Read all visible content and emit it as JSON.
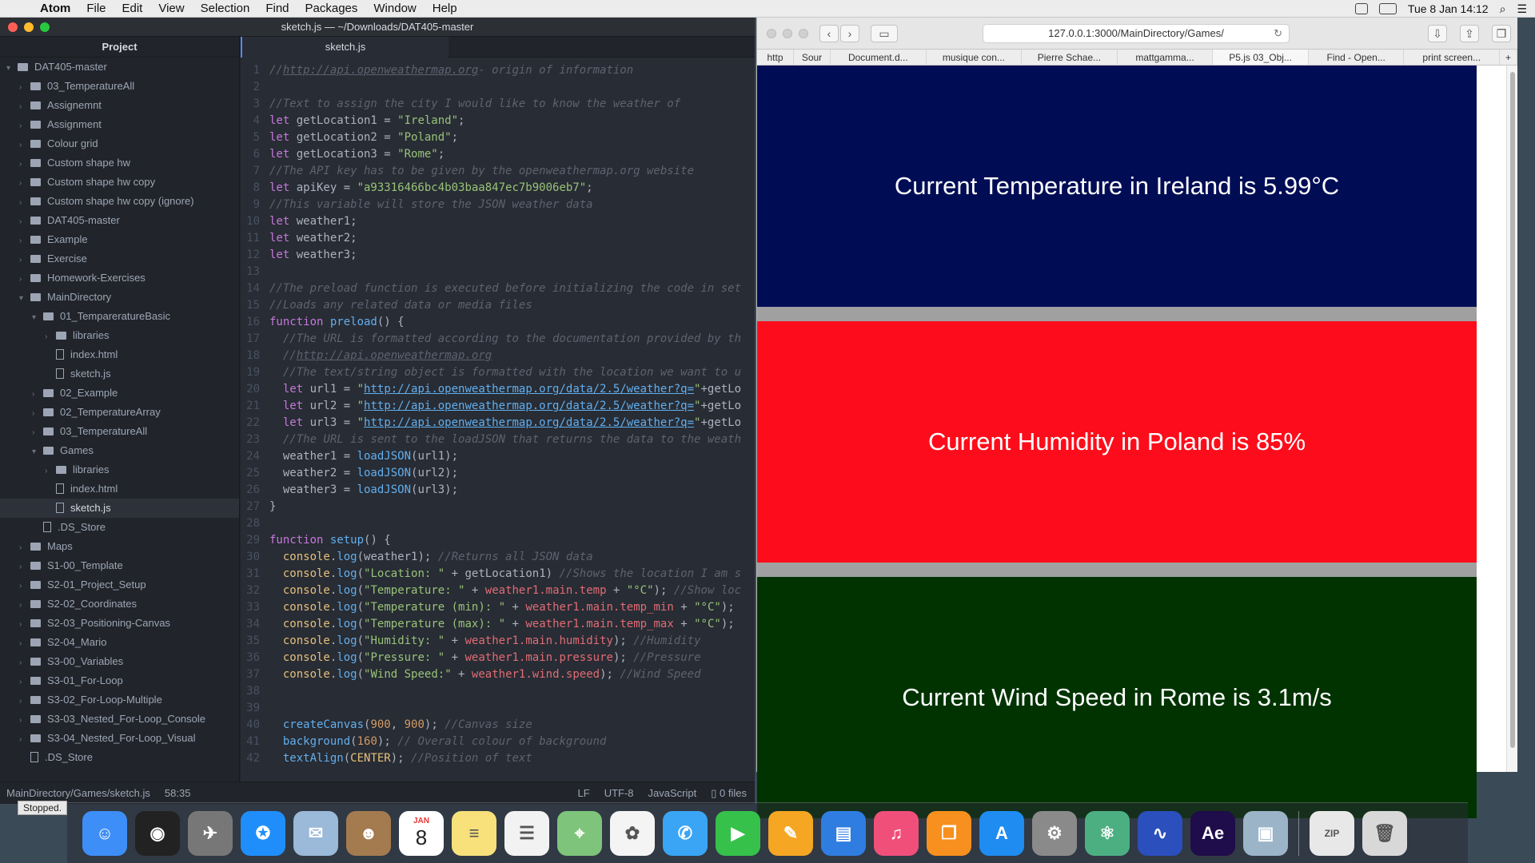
{
  "menubar": {
    "app": "Atom",
    "items": [
      "File",
      "Edit",
      "View",
      "Selection",
      "Find",
      "Packages",
      "Window",
      "Help"
    ],
    "datetime": "Tue 8 Jan  14:12"
  },
  "atom": {
    "title": "sketch.js — ~/Downloads/DAT405-master",
    "tree_header": "Project",
    "tab": "sketch.js",
    "tree": [
      {
        "label": "DAT405-master",
        "depth": 0,
        "type": "folder",
        "open": true
      },
      {
        "label": "03_TemperatureAll",
        "depth": 1,
        "type": "folder"
      },
      {
        "label": "Assignemnt",
        "depth": 1,
        "type": "folder"
      },
      {
        "label": "Assignment",
        "depth": 1,
        "type": "folder"
      },
      {
        "label": "Colour grid",
        "depth": 1,
        "type": "folder"
      },
      {
        "label": "Custom shape hw",
        "depth": 1,
        "type": "folder"
      },
      {
        "label": "Custom shape hw copy",
        "depth": 1,
        "type": "folder"
      },
      {
        "label": "Custom shape hw copy (ignore)",
        "depth": 1,
        "type": "folder"
      },
      {
        "label": "DAT405-master",
        "depth": 1,
        "type": "folder"
      },
      {
        "label": "Example",
        "depth": 1,
        "type": "folder"
      },
      {
        "label": "Exercise",
        "depth": 1,
        "type": "folder"
      },
      {
        "label": "Homework-Exercises",
        "depth": 1,
        "type": "folder"
      },
      {
        "label": "MainDirectory",
        "depth": 1,
        "type": "folder",
        "open": true
      },
      {
        "label": "01_TempareratureBasic",
        "depth": 2,
        "type": "folder",
        "open": true
      },
      {
        "label": "libraries",
        "depth": 3,
        "type": "folder"
      },
      {
        "label": "index.html",
        "depth": 3,
        "type": "file"
      },
      {
        "label": "sketch.js",
        "depth": 3,
        "type": "file"
      },
      {
        "label": "02_Example",
        "depth": 2,
        "type": "folder"
      },
      {
        "label": "02_TemperatureArray",
        "depth": 2,
        "type": "folder"
      },
      {
        "label": "03_TemperatureAll",
        "depth": 2,
        "type": "folder"
      },
      {
        "label": "Games",
        "depth": 2,
        "type": "folder",
        "open": true
      },
      {
        "label": "libraries",
        "depth": 3,
        "type": "folder"
      },
      {
        "label": "index.html",
        "depth": 3,
        "type": "file"
      },
      {
        "label": "sketch.js",
        "depth": 3,
        "type": "file",
        "selected": true
      },
      {
        "label": ".DS_Store",
        "depth": 2,
        "type": "file"
      },
      {
        "label": "Maps",
        "depth": 1,
        "type": "folder"
      },
      {
        "label": "S1-00_Template",
        "depth": 1,
        "type": "folder"
      },
      {
        "label": "S2-01_Project_Setup",
        "depth": 1,
        "type": "folder"
      },
      {
        "label": "S2-02_Coordinates",
        "depth": 1,
        "type": "folder"
      },
      {
        "label": "S2-03_Positioning-Canvas",
        "depth": 1,
        "type": "folder"
      },
      {
        "label": "S2-04_Mario",
        "depth": 1,
        "type": "folder"
      },
      {
        "label": "S3-00_Variables",
        "depth": 1,
        "type": "folder"
      },
      {
        "label": "S3-01_For-Loop",
        "depth": 1,
        "type": "folder"
      },
      {
        "label": "S3-02_For-Loop-Multiple",
        "depth": 1,
        "type": "folder"
      },
      {
        "label": "S3-03_Nested_For-Loop_Console",
        "depth": 1,
        "type": "folder"
      },
      {
        "label": "S3-04_Nested_For-Loop_Visual",
        "depth": 1,
        "type": "folder"
      },
      {
        "label": ".DS_Store",
        "depth": 1,
        "type": "file"
      }
    ],
    "code": [
      [
        [
          "c",
          "//"
        ],
        [
          "cu",
          "http://api.openweathermap.org"
        ],
        [
          "c",
          "- origin of information"
        ]
      ],
      [],
      [
        [
          "c",
          "//Text to assign the city I would like to know the weather of"
        ]
      ],
      [
        [
          "k",
          "let "
        ],
        [
          "p",
          "getLocation1 = "
        ],
        [
          "s",
          "\"Ireland\""
        ],
        [
          "p",
          ";"
        ]
      ],
      [
        [
          "k",
          "let "
        ],
        [
          "p",
          "getLocation2 = "
        ],
        [
          "s",
          "\"Poland\""
        ],
        [
          "p",
          ";"
        ]
      ],
      [
        [
          "k",
          "let "
        ],
        [
          "p",
          "getLocation3 = "
        ],
        [
          "s",
          "\"Rome\""
        ],
        [
          "p",
          ";"
        ]
      ],
      [
        [
          "c",
          "//The API key has to be given by the openweathermap.org website"
        ]
      ],
      [
        [
          "k",
          "let "
        ],
        [
          "p",
          "apiKey = "
        ],
        [
          "s",
          "\"a93316466bc4b03baa847ec7b9006eb7\""
        ],
        [
          "p",
          ";"
        ]
      ],
      [
        [
          "c",
          "//This variable will store the JSON weather data"
        ]
      ],
      [
        [
          "k",
          "let "
        ],
        [
          "p",
          "weather1;"
        ]
      ],
      [
        [
          "k",
          "let "
        ],
        [
          "p",
          "weather2;"
        ]
      ],
      [
        [
          "k",
          "let "
        ],
        [
          "p",
          "weather3;"
        ]
      ],
      [],
      [
        [
          "c",
          "//The preload function is executed before initializing the code in set"
        ]
      ],
      [
        [
          "c",
          "//Loads any related data or media files"
        ]
      ],
      [
        [
          "k",
          "function "
        ],
        [
          "f",
          "preload"
        ],
        [
          "p",
          "() {"
        ]
      ],
      [
        [
          "p",
          "  "
        ],
        [
          "c",
          "//The URL is formatted according to the documentation provided by th"
        ]
      ],
      [
        [
          "p",
          "  "
        ],
        [
          "c",
          "//"
        ],
        [
          "cu",
          "http://api.openweathermap.org"
        ]
      ],
      [
        [
          "p",
          "  "
        ],
        [
          "c",
          "//The text/string object is formatted with the location we want to u"
        ]
      ],
      [
        [
          "p",
          "  "
        ],
        [
          "k",
          "let "
        ],
        [
          "p",
          "url1 = "
        ],
        [
          "s",
          "\""
        ],
        [
          "su",
          "http://api.openweathermap.org/data/2.5/weather?q="
        ],
        [
          "s",
          "\""
        ],
        [
          "p",
          "+getLo"
        ]
      ],
      [
        [
          "p",
          "  "
        ],
        [
          "k",
          "let "
        ],
        [
          "p",
          "url2 = "
        ],
        [
          "s",
          "\""
        ],
        [
          "su",
          "http://api.openweathermap.org/data/2.5/weather?q="
        ],
        [
          "s",
          "\""
        ],
        [
          "p",
          "+getLo"
        ]
      ],
      [
        [
          "p",
          "  "
        ],
        [
          "k",
          "let "
        ],
        [
          "p",
          "url3 = "
        ],
        [
          "s",
          "\""
        ],
        [
          "su",
          "http://api.openweathermap.org/data/2.5/weather?q="
        ],
        [
          "s",
          "\""
        ],
        [
          "p",
          "+getLo"
        ]
      ],
      [
        [
          "p",
          "  "
        ],
        [
          "c",
          "//The URL is sent to the loadJSON that returns the data to the weath"
        ]
      ],
      [
        [
          "p",
          "  weather1 = "
        ],
        [
          "f",
          "loadJSON"
        ],
        [
          "p",
          "(url1);"
        ]
      ],
      [
        [
          "p",
          "  weather2 = "
        ],
        [
          "f",
          "loadJSON"
        ],
        [
          "p",
          "(url2);"
        ]
      ],
      [
        [
          "p",
          "  weather3 = "
        ],
        [
          "f",
          "loadJSON"
        ],
        [
          "p",
          "(url3);"
        ]
      ],
      [
        [
          "p",
          "}"
        ]
      ],
      [],
      [
        [
          "k",
          "function "
        ],
        [
          "f",
          "setup"
        ],
        [
          "p",
          "() {"
        ]
      ],
      [
        [
          "p",
          "  "
        ],
        [
          "y",
          "console"
        ],
        [
          "p",
          "."
        ],
        [
          "f",
          "log"
        ],
        [
          "p",
          "(weather1); "
        ],
        [
          "c",
          "//Returns all JSON data"
        ]
      ],
      [
        [
          "p",
          "  "
        ],
        [
          "y",
          "console"
        ],
        [
          "p",
          "."
        ],
        [
          "f",
          "log"
        ],
        [
          "p",
          "("
        ],
        [
          "s",
          "\"Location: \""
        ],
        [
          "p",
          " + getLocation1) "
        ],
        [
          "c",
          "//Shows the location I am s"
        ]
      ],
      [
        [
          "p",
          "  "
        ],
        [
          "y",
          "console"
        ],
        [
          "p",
          "."
        ],
        [
          "f",
          "log"
        ],
        [
          "p",
          "("
        ],
        [
          "s",
          "\"Temperature: \""
        ],
        [
          "p",
          " + "
        ],
        [
          "r",
          "weather1.main.temp"
        ],
        [
          "p",
          " + "
        ],
        [
          "s",
          "\"°C\""
        ],
        [
          "p",
          "); "
        ],
        [
          "c",
          "//Show loc"
        ]
      ],
      [
        [
          "p",
          "  "
        ],
        [
          "y",
          "console"
        ],
        [
          "p",
          "."
        ],
        [
          "f",
          "log"
        ],
        [
          "p",
          "("
        ],
        [
          "s",
          "\"Temperature (min): \""
        ],
        [
          "p",
          " + "
        ],
        [
          "r",
          "weather1.main.temp_min"
        ],
        [
          "p",
          " + "
        ],
        [
          "s",
          "\"°C\""
        ],
        [
          "p",
          ");"
        ]
      ],
      [
        [
          "p",
          "  "
        ],
        [
          "y",
          "console"
        ],
        [
          "p",
          "."
        ],
        [
          "f",
          "log"
        ],
        [
          "p",
          "("
        ],
        [
          "s",
          "\"Temperature (max): \""
        ],
        [
          "p",
          " + "
        ],
        [
          "r",
          "weather1.main.temp_max"
        ],
        [
          "p",
          " + "
        ],
        [
          "s",
          "\"°C\""
        ],
        [
          "p",
          ");"
        ]
      ],
      [
        [
          "p",
          "  "
        ],
        [
          "y",
          "console"
        ],
        [
          "p",
          "."
        ],
        [
          "f",
          "log"
        ],
        [
          "p",
          "("
        ],
        [
          "s",
          "\"Humidity: \""
        ],
        [
          "p",
          " + "
        ],
        [
          "r",
          "weather1.main.humidity"
        ],
        [
          "p",
          "); "
        ],
        [
          "c",
          "//Humidity"
        ]
      ],
      [
        [
          "p",
          "  "
        ],
        [
          "y",
          "console"
        ],
        [
          "p",
          "."
        ],
        [
          "f",
          "log"
        ],
        [
          "p",
          "("
        ],
        [
          "s",
          "\"Pressure: \""
        ],
        [
          "p",
          " + "
        ],
        [
          "r",
          "weather1.main.pressure"
        ],
        [
          "p",
          "); "
        ],
        [
          "c",
          "//Pressure"
        ]
      ],
      [
        [
          "p",
          "  "
        ],
        [
          "y",
          "console"
        ],
        [
          "p",
          "."
        ],
        [
          "f",
          "log"
        ],
        [
          "p",
          "("
        ],
        [
          "s",
          "\"Wind Speed:\""
        ],
        [
          "p",
          " + "
        ],
        [
          "r",
          "weather1.wind.speed"
        ],
        [
          "p",
          "); "
        ],
        [
          "c",
          "//Wind Speed"
        ]
      ],
      [],
      [],
      [
        [
          "p",
          "  "
        ],
        [
          "f",
          "createCanvas"
        ],
        [
          "p",
          "("
        ],
        [
          "n",
          "900"
        ],
        [
          "p",
          ", "
        ],
        [
          "n",
          "900"
        ],
        [
          "p",
          "); "
        ],
        [
          "c",
          "//Canvas size"
        ]
      ],
      [
        [
          "p",
          "  "
        ],
        [
          "f",
          "background"
        ],
        [
          "p",
          "("
        ],
        [
          "n",
          "160"
        ],
        [
          "p",
          "); "
        ],
        [
          "c",
          "// Overall colour of background"
        ]
      ],
      [
        [
          "p",
          "  "
        ],
        [
          "f",
          "textAlign"
        ],
        [
          "p",
          "("
        ],
        [
          "y",
          "CENTER"
        ],
        [
          "p",
          "); "
        ],
        [
          "c",
          "//Position of text"
        ]
      ]
    ],
    "status": {
      "path": "MainDirectory/Games/sketch.js",
      "cursor": "58:35",
      "eol": "LF",
      "encoding": "UTF-8",
      "grammar": "JavaScript",
      "files": "0 files"
    }
  },
  "safari": {
    "url": "127.0.0.1:3000/MainDirectory/Games/",
    "bookmarks": [
      "http",
      "Sour",
      "Document.d...",
      "musique con...",
      "Pierre Schae...",
      "mattgamma...",
      "P5.js 03_Obj...",
      "Find - Open...",
      "print screen..."
    ],
    "active_bookmark": 6,
    "panels": [
      {
        "text": "Current Temperature in Ireland is 5.99°C",
        "color": "#000d55"
      },
      {
        "text": "Current Humidity in Poland is 85%",
        "color": "#fd0d1b"
      },
      {
        "text": "Current Wind Speed in Rome is 3.1m/s",
        "color": "#013301"
      }
    ]
  },
  "dock": {
    "tooltip": "Stopped.",
    "calendar_month": "JAN",
    "calendar_day": "8",
    "apps": [
      {
        "name": "finder-icon",
        "color": "#3e8ef7",
        "glyph": "☺"
      },
      {
        "name": "siri-icon",
        "color": "#222",
        "glyph": "◉"
      },
      {
        "name": "launchpad-icon",
        "color": "#777",
        "glyph": "✈"
      },
      {
        "name": "safari-icon",
        "color": "#1f8efa",
        "glyph": "✪"
      },
      {
        "name": "mail-icon",
        "color": "#9bb9d8",
        "glyph": "✉"
      },
      {
        "name": "contacts-icon",
        "color": "#a47a4f",
        "glyph": "☻"
      },
      {
        "name": "calendar-icon",
        "color": "#ffffff",
        "glyph": ""
      },
      {
        "name": "notes-icon",
        "color": "#f8e17a",
        "glyph": "≡"
      },
      {
        "name": "reminders-icon",
        "color": "#f2f2f2",
        "glyph": "☰"
      },
      {
        "name": "maps-icon",
        "color": "#7ec47a",
        "glyph": "⌖"
      },
      {
        "name": "photos-icon",
        "color": "#f4f4f4",
        "glyph": "✿"
      },
      {
        "name": "messages-icon",
        "color": "#3aa5f5",
        "glyph": "✆"
      },
      {
        "name": "facetime-icon",
        "color": "#36c24a",
        "glyph": "▶"
      },
      {
        "name": "pages-icon",
        "color": "#f5a623",
        "glyph": "✎"
      },
      {
        "name": "keynote-icon",
        "color": "#2f7de1",
        "glyph": "▤"
      },
      {
        "name": "itunes-icon",
        "color": "#f04f7a",
        "glyph": "♫"
      },
      {
        "name": "ibooks-icon",
        "color": "#f7901e",
        "glyph": "❐"
      },
      {
        "name": "app-store-icon",
        "color": "#1e8cf0",
        "glyph": "A"
      },
      {
        "name": "system-preferences-icon",
        "color": "#8a8a8a",
        "glyph": "⚙"
      },
      {
        "name": "atom-icon",
        "color": "#4caf82",
        "glyph": "⚛"
      },
      {
        "name": "audacity-icon",
        "color": "#2b4fbd",
        "glyph": "∿"
      },
      {
        "name": "after-effects-icon",
        "color": "#1f0c4a",
        "glyph": "Ae"
      },
      {
        "name": "preview-icon",
        "color": "#9cb4c8",
        "glyph": "▣"
      },
      {
        "name": "archive-icon",
        "color": "#e8e8e8",
        "glyph": "ZIP"
      },
      {
        "name": "trash-icon",
        "color": "#d8d8d8",
        "glyph": "🗑"
      }
    ]
  },
  "colors": {
    "comment": "#5c6370",
    "keyword": "#c678dd",
    "string": "#98c379",
    "function": "#61afef",
    "property": "#e06c75",
    "number": "#d19a66",
    "builtin": "#e5c07b"
  }
}
